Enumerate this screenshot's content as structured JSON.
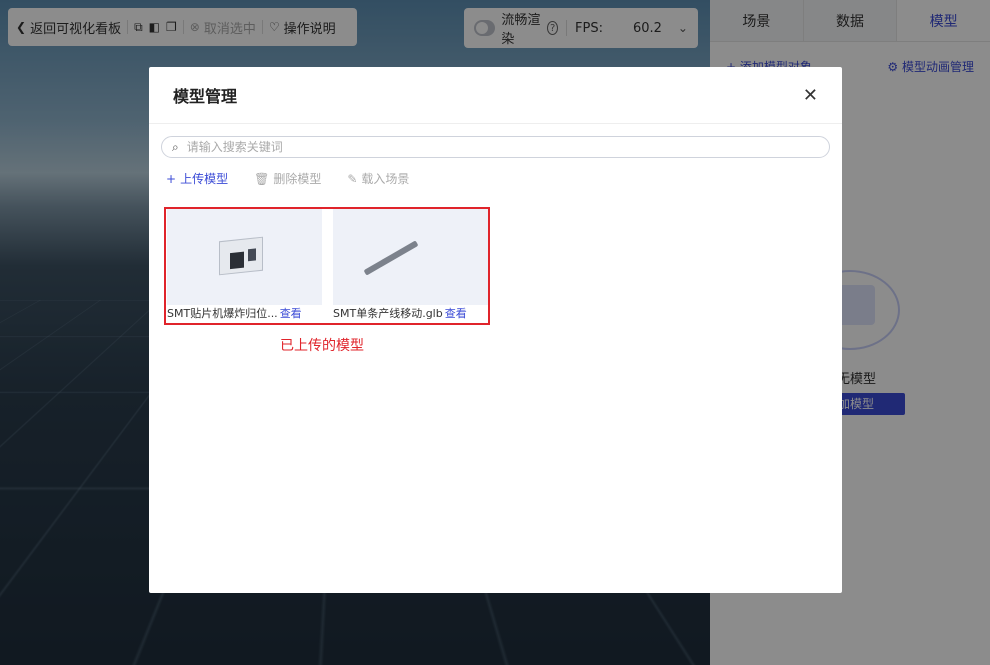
{
  "toolbar": {
    "back_label": "返回可视化看板",
    "cancel_select_label": "取消选中",
    "instructions_label": "操作说明"
  },
  "fps_panel": {
    "smooth_render_label": "流畅渲染",
    "fps_label": "FPS:",
    "fps_value": "60.2"
  },
  "right_panel": {
    "tabs": [
      {
        "label": "场景"
      },
      {
        "label": "数据"
      },
      {
        "label": "模型"
      }
    ],
    "add_object_label": "添加模型对象",
    "animation_manage_label": "模型动画管理",
    "empty_text": "暂无模型",
    "add_button_label": "添加模型"
  },
  "modal": {
    "title": "模型管理",
    "search_placeholder": "请输入搜索关键词",
    "actions": {
      "upload": "上传模型",
      "delete": "删除模型",
      "load": "载入场景"
    },
    "cards": [
      {
        "name": "SMT贴片机爆炸归位...",
        "view": "查看"
      },
      {
        "name": "SMT单条产线移动.glb",
        "view": "查看"
      }
    ],
    "annotation": "已上传的模型"
  },
  "colors": {
    "accent": "#3b4bd6",
    "annotation_red": "#e0242b"
  }
}
